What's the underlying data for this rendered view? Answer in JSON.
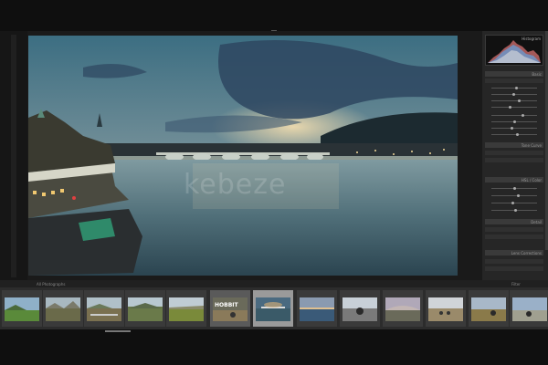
{
  "viewer": {
    "watermark_text": "kebeze",
    "accent_color": "#5aa0ff"
  },
  "right_panel": {
    "histogram_label": "Histogram",
    "sections": [
      "Basic",
      "Tone Curve",
      "HSL / Color",
      "Detail",
      "Lens Corrections"
    ],
    "slider_levels": [
      0.55,
      0.48,
      0.62,
      0.4,
      0.7,
      0.5,
      0.45,
      0.58,
      0.52,
      0.6,
      0.47,
      0.53
    ]
  },
  "toolbar": {
    "left_text": "All Photographs",
    "right_text": "Filter"
  },
  "filmstrip": {
    "thumbnails": [
      {
        "scene": "green-hills",
        "text": ""
      },
      {
        "scene": "rocky-valley",
        "text": ""
      },
      {
        "scene": "mountain-road",
        "text": ""
      },
      {
        "scene": "green-valley",
        "text": ""
      },
      {
        "scene": "field",
        "text": ""
      },
      {
        "scene": "cyclist-sign",
        "text": "HOBBIT"
      },
      {
        "scene": "river-bridge",
        "text": ""
      },
      {
        "scene": "lake-sunset",
        "text": ""
      },
      {
        "scene": "motorbike-road",
        "text": ""
      },
      {
        "scene": "dusk-horizon",
        "text": ""
      },
      {
        "scene": "desert-road",
        "text": ""
      },
      {
        "scene": "hill-road",
        "text": ""
      },
      {
        "scene": "sky-vista",
        "text": ""
      }
    ]
  }
}
